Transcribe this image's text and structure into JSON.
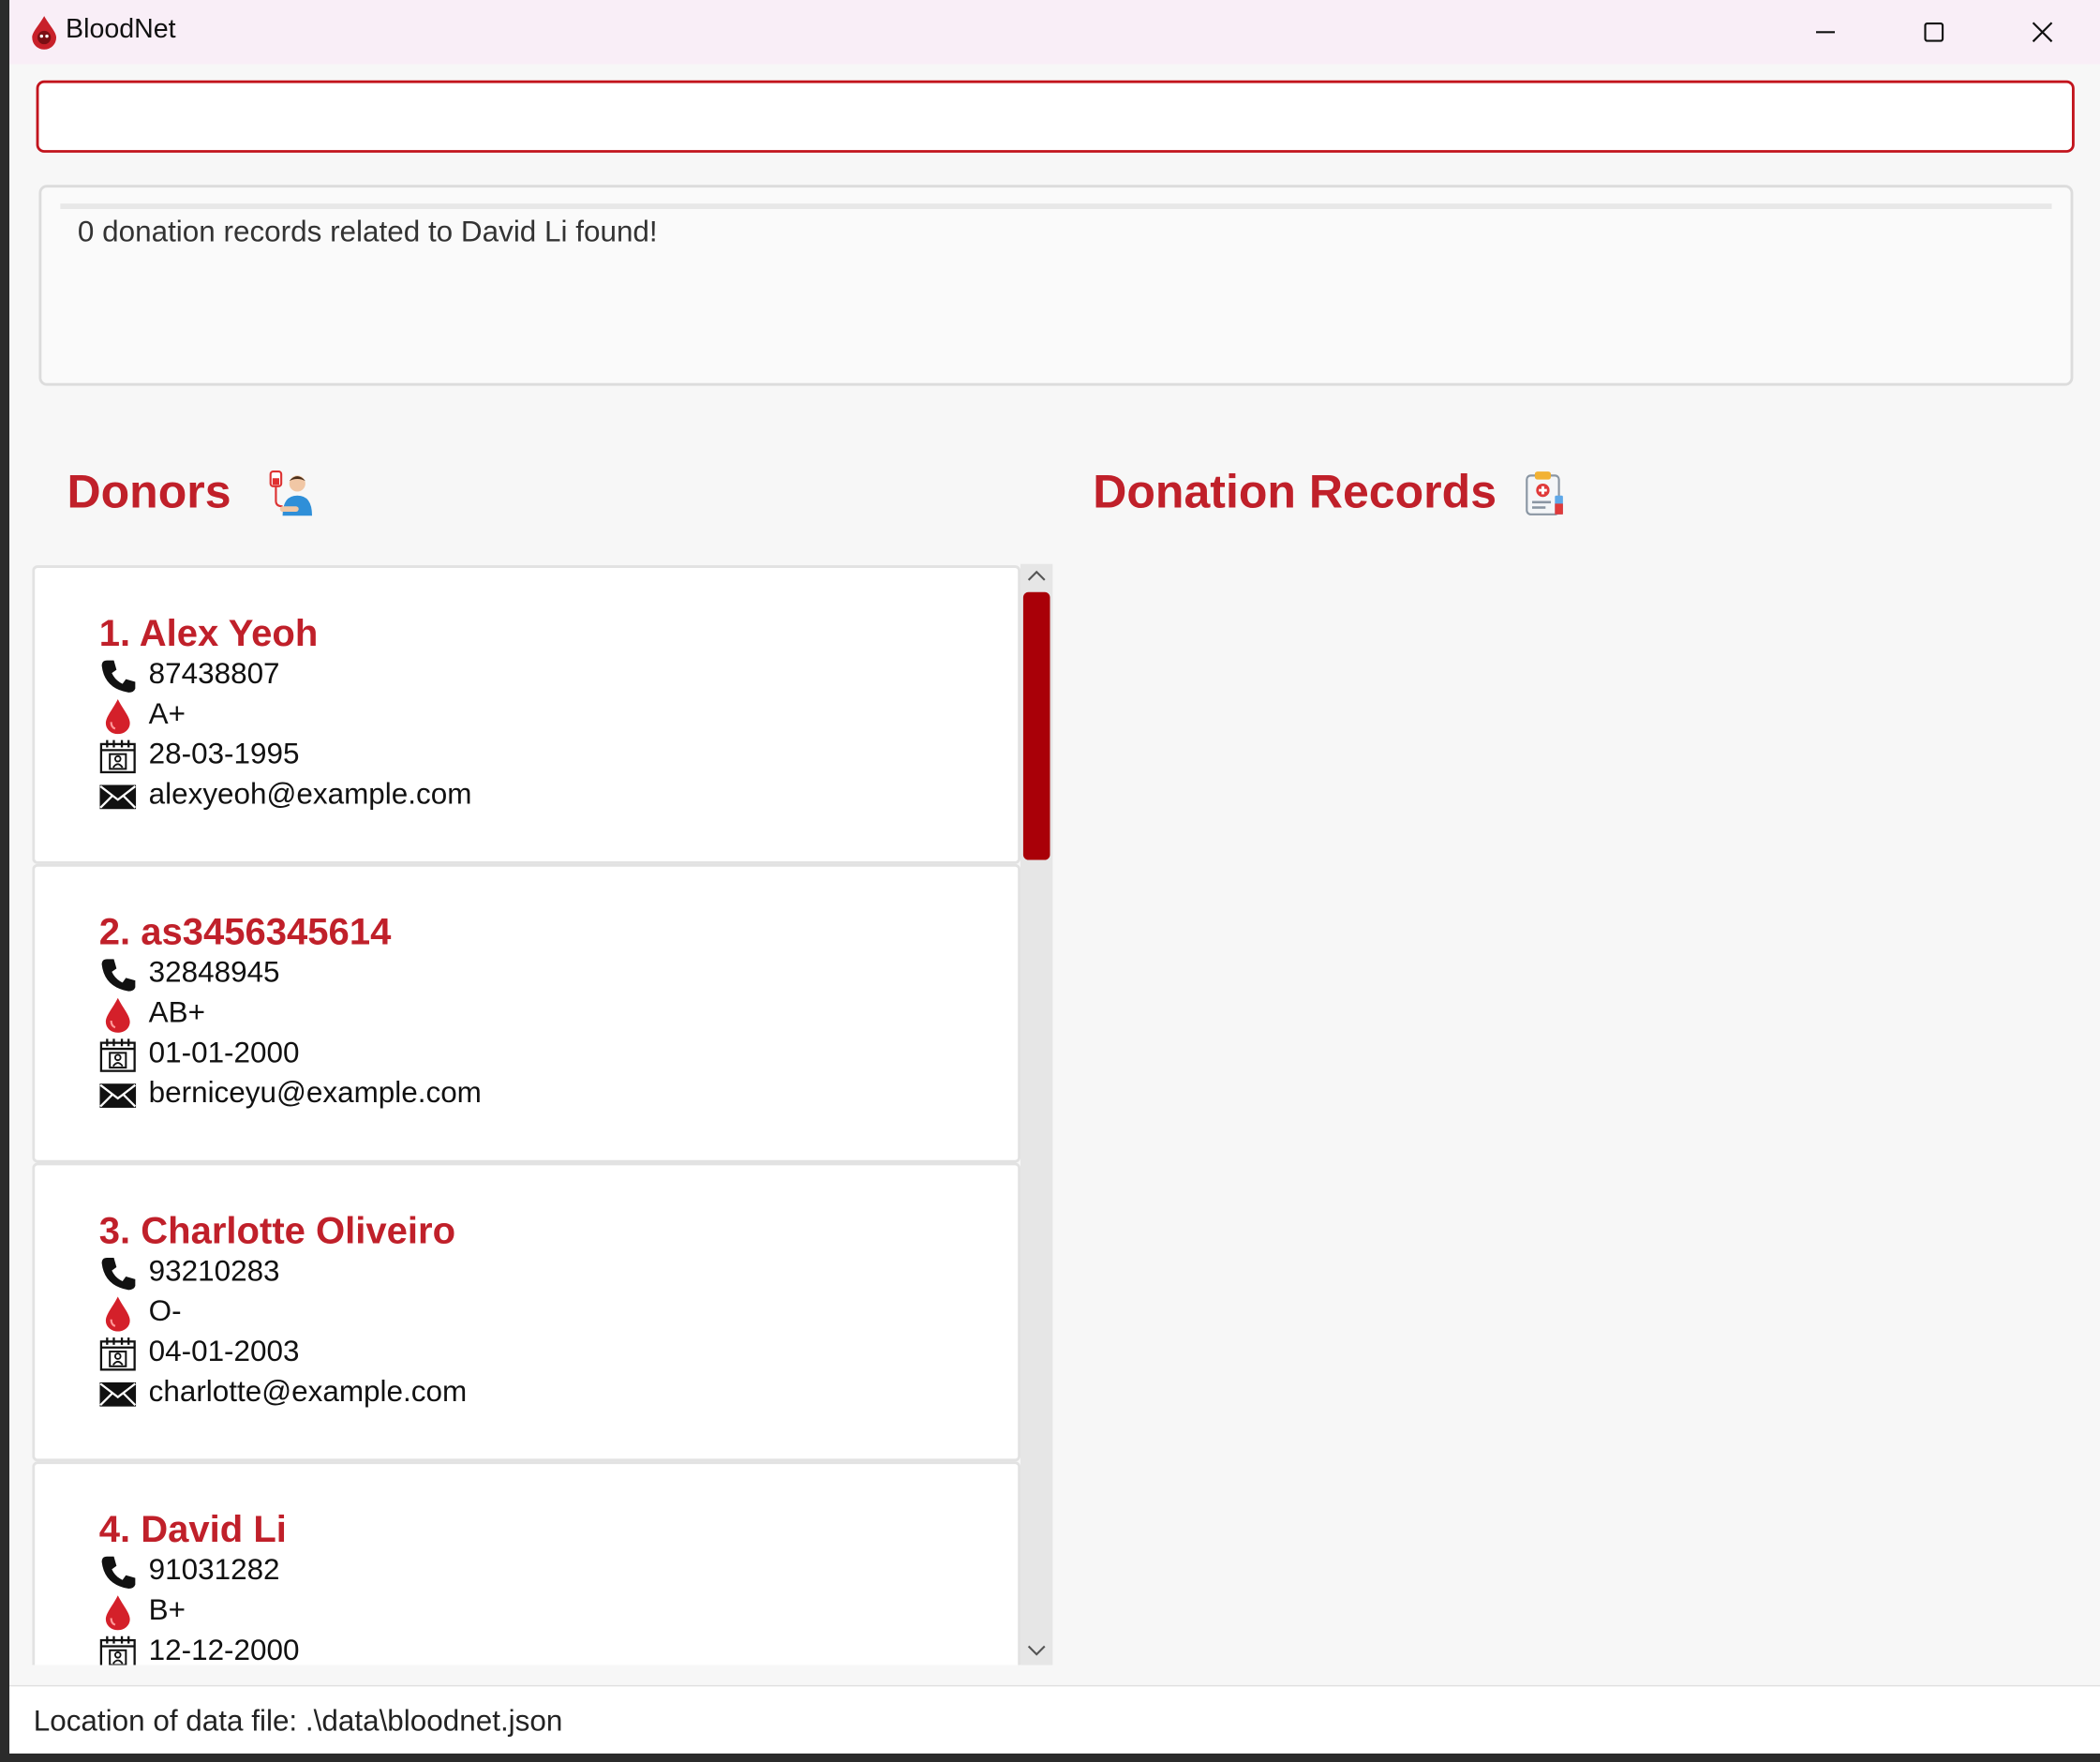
{
  "window": {
    "title": "BloodNet"
  },
  "command": {
    "value": "",
    "placeholder": ""
  },
  "result": {
    "message": "0 donation records related to David Li found!"
  },
  "donors": {
    "title": "Donors",
    "items": [
      {
        "name": "1. Alex Yeoh",
        "phone": "87438807",
        "blood_type": "A+",
        "dob": "28-03-1995",
        "email": "alexyeoh@example.com"
      },
      {
        "name": "2. as3456345614",
        "phone": "32848945",
        "blood_type": "AB+",
        "dob": "01-01-2000",
        "email": "berniceyu@example.com"
      },
      {
        "name": "3. Charlotte Oliveiro",
        "phone": "93210283",
        "blood_type": "O-",
        "dob": "04-01-2003",
        "email": "charlotte@example.com"
      },
      {
        "name": "4. David Li",
        "phone": "91031282",
        "blood_type": "B+",
        "dob": "12-12-2000",
        "email": ""
      }
    ]
  },
  "records": {
    "title": "Donation Records"
  },
  "status": {
    "text": "Location of data file: .\\data\\bloodnet.json"
  },
  "colors": {
    "accent": "#c0202a",
    "scroll_thumb": "#a90008",
    "titlebar": "#f9eef7"
  }
}
